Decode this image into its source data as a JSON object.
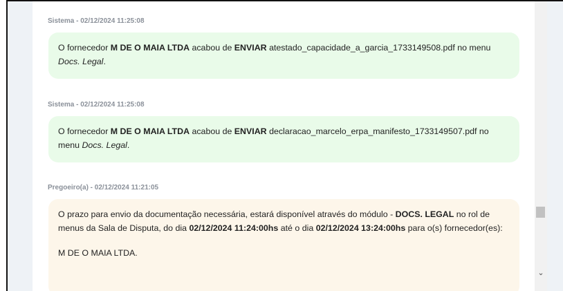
{
  "messages": [
    {
      "header": "Sistema - 02/12/2024 11:25:08",
      "p1": "O fornecedor ",
      "supplier": "M DE O MAIA LTDA",
      "p2": " acabou de ",
      "action": "ENVIAR",
      "p3": " atestado_capacidade_a_garcia_1733149508.pdf no menu ",
      "menu": "Docs. Legal",
      "p4": "."
    },
    {
      "header": "Sistema - 02/12/2024 11:25:08",
      "p1": "O fornecedor ",
      "supplier": "M DE O MAIA LTDA",
      "p2": " acabou de ",
      "action": "ENVIAR",
      "p3": " declaracao_marcelo_erpa_manifesto_1733149507.pdf no menu ",
      "menu": "Docs. Legal",
      "p4": "."
    },
    {
      "header": "Pregoeiro(a) - 02/12/2024 11:21:05",
      "p1": "O prazo para envio da documentação necessária, estará disponível através do módulo - ",
      "module": "DOCS. LEGAL",
      "p2": " no rol de menus da Sala de Disputa, do dia ",
      "date_start": "02/12/2024 11:24:00hs",
      "p3": " até o dia ",
      "date_end": "02/12/2024 13:24:00hs",
      "p4": " para o(s) fornecedor(es):",
      "suppliers_list": "M DE O MAIA LTDA."
    }
  ],
  "scrollbar": {
    "down_arrow": "⌄"
  },
  "colors": {
    "system_bubble": "#e9fbe9",
    "pregoeiro_bubble": "#fdf6ea",
    "header_text": "#8a9099",
    "side_panel": "#eef2f6"
  }
}
